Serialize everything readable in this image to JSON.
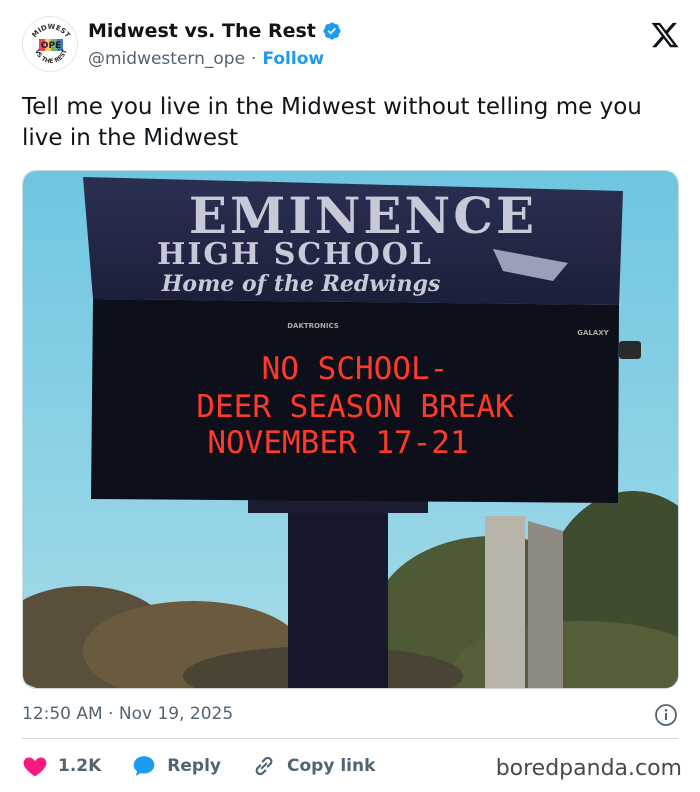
{
  "author": {
    "display_name": "Midwest vs. The Rest",
    "handle": "@midwestern_ope",
    "separator": "·",
    "follow_label": "Follow",
    "avatar_text": {
      "top": "MIDWEST",
      "center": "OPE",
      "bottom": "VS THE REST"
    }
  },
  "tweet": {
    "text": "Tell me you live in the Midwest without telling me you live in the Midwest"
  },
  "media": {
    "sign_title": "EMINENCE",
    "sign_subtitle": "HIGH SCHOOL",
    "sign_tagline": "Home of the Redwings",
    "brand_left": "DAKTRONICS",
    "brand_right": "GALAXY",
    "led_line1": "NO SCHOOL-",
    "led_line2": "DEER SEASON BREAK",
    "led_line3": "NOVEMBER 17-21"
  },
  "meta": {
    "timestamp": "12:50 AM · Nov 19, 2025"
  },
  "actions": {
    "like_count": "1.2K",
    "reply_label": "Reply",
    "copy_link_label": "Copy link"
  },
  "watermark": "boredpanda.com",
  "colors": {
    "verified_blue": "#1d9bf0",
    "like_pink": "#f91880",
    "led_red": "#ff3a2a"
  }
}
